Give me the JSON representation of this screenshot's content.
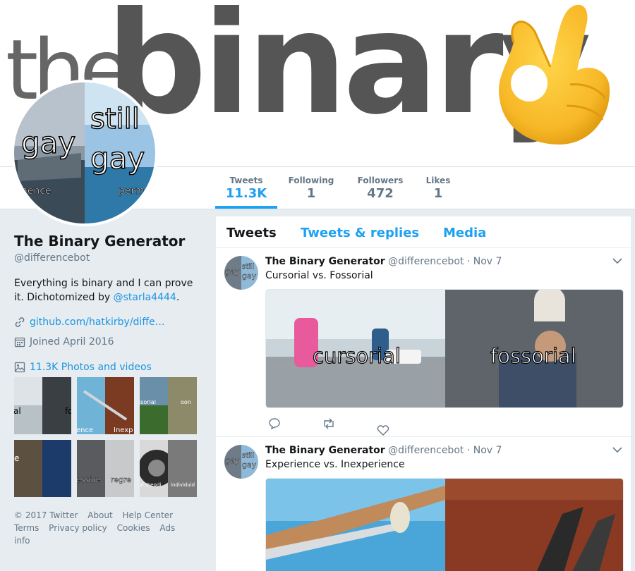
{
  "banner": {
    "word_the": "the",
    "word_binary": "binary",
    "emoji_name": "ok-hand-emoji"
  },
  "stats": [
    {
      "label": "Tweets",
      "value": "11.3K"
    },
    {
      "label": "Following",
      "value": "1"
    },
    {
      "label": "Followers",
      "value": "472"
    },
    {
      "label": "Likes",
      "value": "1"
    }
  ],
  "avatar_words": {
    "top": "still",
    "left": "gay",
    "right": "gay",
    "left_bottom": "nence",
    "right_bottom": "perm"
  },
  "profile": {
    "name": "The Binary Generator",
    "handle": "@differencebot",
    "bio_text": "Everything is binary and I can prove it. Dichotomized by ",
    "bio_mention": "@starla4444",
    "bio_end": ".",
    "website": "github.com/hatkirby/diffe…",
    "joined": "Joined April 2016",
    "photos_label": "11.3K Photos and videos"
  },
  "thumbs": [
    {
      "left": "al",
      "right": "fo"
    },
    {
      "left": "ence",
      "right": "Inexp"
    },
    {
      "left": "isorial",
      "right": "oon"
    },
    {
      "left": "e",
      "right": ""
    },
    {
      "left": "essive",
      "right": "regre"
    },
    {
      "left": "uf theodi",
      "right": "individuid"
    }
  ],
  "footer": {
    "row1": [
      "© 2017 Twitter",
      "About",
      "Help Center"
    ],
    "row2": [
      "Terms",
      "Privacy policy",
      "Cookies",
      "Ads info"
    ]
  },
  "tabs": [
    "Tweets",
    "Tweets & replies",
    "Media"
  ],
  "tweets": [
    {
      "name": "The Binary Generator",
      "handle": "@differencebot",
      "date": "Nov 7",
      "text": "Cursorial vs. Fossorial",
      "img_left": "cursorial",
      "img_right": "fossorial"
    },
    {
      "name": "The Binary Generator",
      "handle": "@differencebot",
      "date": "Nov 7",
      "text": "Experience vs. Inexperience",
      "img_left": "",
      "img_right": ""
    }
  ],
  "colors": {
    "accent": "#1da1f2",
    "link": "#1b95e0",
    "muted": "#657786",
    "bg": "#e6ecf0"
  }
}
